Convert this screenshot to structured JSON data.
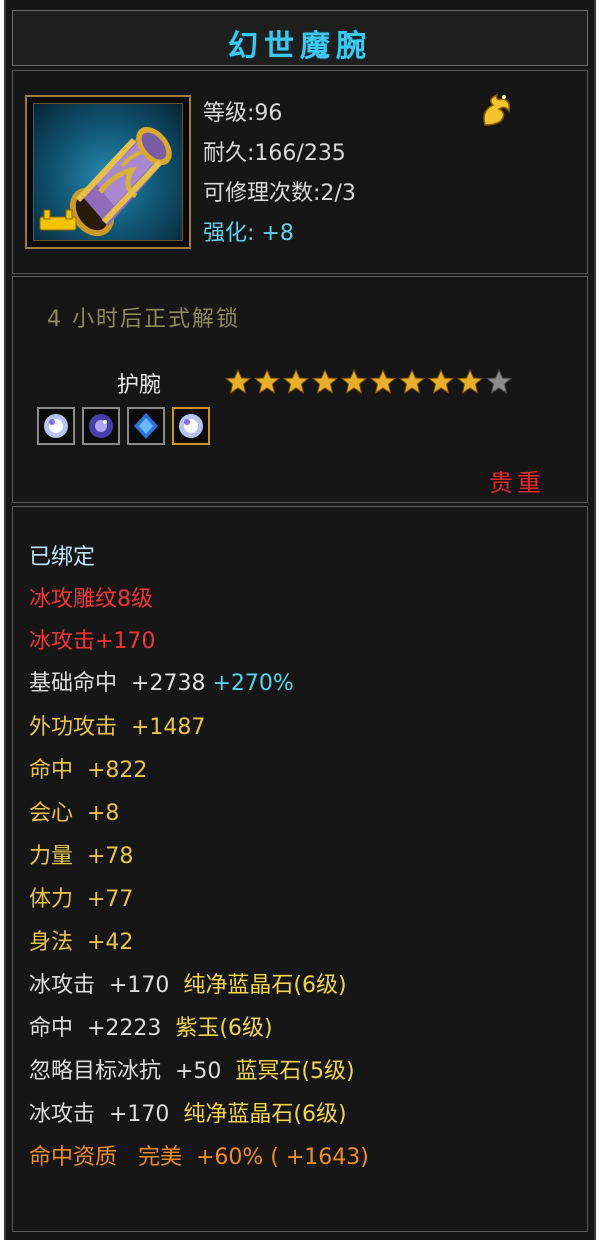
{
  "item": {
    "name": "幻世魔腕",
    "level": "等级:96",
    "durability": "耐久:166/235",
    "repairs": "可修理次数:2/3",
    "enhance_label": "强化:",
    "enhance_value": "+8"
  },
  "lock": {
    "unlock_text": "4 小时后正式解锁",
    "slot_label": "护腕",
    "stars_filled": 9,
    "stars_total": 10,
    "precious": "贵重"
  },
  "icons": {
    "item": "purple-gold-bracer-icon",
    "bind": "gold-lock-badge-icon",
    "gold": "golden-dragon-icon",
    "gems": [
      "white-diamond-gem-icon",
      "purple-jade-gem-icon",
      "blue-crystal-gem-icon",
      "white-diamond-gem-icon"
    ]
  },
  "colors": {
    "title": "#3fc8ee",
    "red": "#ef3535",
    "yellow": "#e8c24a",
    "cyan": "#52d4ec",
    "orange": "#ef8c24"
  },
  "stats": {
    "bound": "已绑定",
    "engrave": "冰攻雕纹8级",
    "engrave_bonus": "冰攻击+170",
    "base_hit_label": "基础命中",
    "base_hit_value": "+2738",
    "base_hit_pct": "+270%",
    "outer_attack": "外功攻击  +1487",
    "hit": "命中  +822",
    "crit": "会心  +8",
    "power": "力量  +78",
    "stamina": "体力  +77",
    "agility": "身法  +42",
    "gem1_stat": "冰攻击  +170  ",
    "gem1_name": "纯净蓝晶石(6级)",
    "gem2_stat": "命中  +2223  ",
    "gem2_name": "紫玉(6级)",
    "gem3_stat": "忽略目标冰抗  +50  ",
    "gem3_name": "蓝冥石(5级)",
    "gem4_stat": "冰攻击  +170  ",
    "gem4_name": "纯净蓝晶石(6级)",
    "aptitude": "命中资质   完美  +60% ( +1643)"
  }
}
